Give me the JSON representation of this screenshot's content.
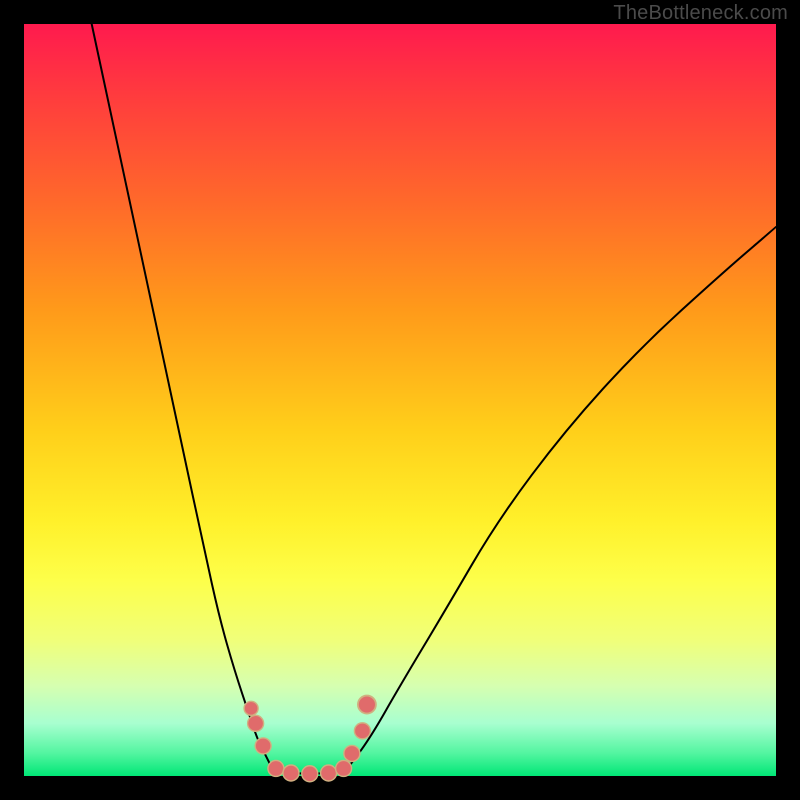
{
  "watermark": "TheBottleneck.com",
  "chart_data": {
    "type": "line",
    "title": "",
    "xlabel": "",
    "ylabel": "",
    "xlim": [
      0,
      100
    ],
    "ylim": [
      0,
      100
    ],
    "grid": false,
    "legend": false,
    "background_gradient": {
      "orientation": "vertical",
      "stops": [
        {
          "pos": 0,
          "color": "#ff1a4e"
        },
        {
          "pos": 50,
          "color": "#ffcf1a"
        },
        {
          "pos": 80,
          "color": "#f0ff7a"
        },
        {
          "pos": 100,
          "color": "#00e676"
        }
      ]
    },
    "series": [
      {
        "name": "left-branch",
        "x": [
          9,
          12,
          15,
          18,
          21,
          24,
          26,
          28,
          30,
          31,
          32,
          33
        ],
        "y": [
          100,
          86,
          72,
          58,
          44,
          30,
          21,
          14,
          8,
          5,
          3,
          1
        ]
      },
      {
        "name": "valley-floor",
        "x": [
          33,
          35,
          38,
          41,
          43
        ],
        "y": [
          1,
          0.4,
          0.3,
          0.4,
          1
        ]
      },
      {
        "name": "right-branch",
        "x": [
          43,
          46,
          50,
          56,
          63,
          72,
          82,
          93,
          100
        ],
        "y": [
          1,
          5,
          12,
          22,
          34,
          46,
          57,
          67,
          73
        ]
      }
    ],
    "markers": {
      "name": "bottleneck-points",
      "color": "#e06b6b",
      "x": [
        30.2,
        30.8,
        31.8,
        33.5,
        35.5,
        38.0,
        40.5,
        42.5,
        43.6,
        45.0,
        45.6
      ],
      "y": [
        9.0,
        7.0,
        4.0,
        1.0,
        0.4,
        0.3,
        0.4,
        1.0,
        3.0,
        6.0,
        9.5
      ],
      "r": [
        7,
        8,
        8,
        8,
        8,
        8,
        8,
        8,
        8,
        8,
        9
      ]
    }
  }
}
